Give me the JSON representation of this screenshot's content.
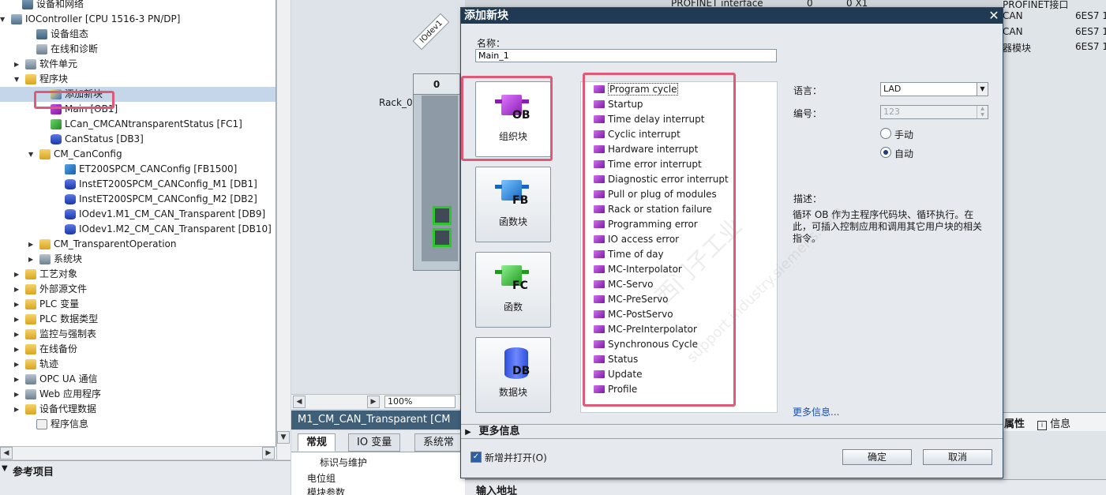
{
  "tree": {
    "items": [
      {
        "label": "设备和网络",
        "icon": "network-icon",
        "cls": "dev",
        "indent": 28,
        "toggle": ""
      },
      {
        "label": "IOController [CPU 1516-3 PN/DP]",
        "icon": "plc-icon",
        "cls": "plc",
        "indent": 14,
        "toggle": "▼"
      },
      {
        "label": "设备组态",
        "icon": "device-config-icon",
        "cls": "dev",
        "indent": 46,
        "toggle": ""
      },
      {
        "label": "在线和诊断",
        "icon": "online-diagnostics-icon",
        "cls": "gen",
        "indent": 46,
        "toggle": ""
      },
      {
        "label": "软件单元",
        "icon": "software-unit-icon",
        "cls": "gen",
        "indent": 32,
        "toggle": "▶"
      },
      {
        "label": "程序块",
        "icon": "folder-icon",
        "cls": "folder",
        "indent": 32,
        "toggle": "▼"
      },
      {
        "label": "添加新块",
        "icon": "add-block-icon",
        "cls": "add",
        "indent": 64,
        "toggle": "",
        "selected": true
      },
      {
        "label": "Main [OB1]",
        "icon": "ob-block-icon",
        "cls": "ob",
        "indent": 64,
        "toggle": ""
      },
      {
        "label": "LCan_CMCANtransparentStatus [FC1]",
        "icon": "fc-block-icon",
        "cls": "fc",
        "indent": 64,
        "toggle": ""
      },
      {
        "label": "CanStatus [DB3]",
        "icon": "db-block-icon",
        "cls": "db",
        "indent": 64,
        "toggle": ""
      },
      {
        "label": "CM_CanConfig",
        "icon": "folder-icon",
        "cls": "folder",
        "indent": 50,
        "toggle": "▼"
      },
      {
        "label": "ET200SPCM_CANConfig [FB1500]",
        "icon": "fb-block-icon",
        "cls": "fb",
        "indent": 82,
        "toggle": ""
      },
      {
        "label": "InstET200SPCM_CANConfig_M1 [DB1]",
        "icon": "db-block-icon",
        "cls": "db",
        "indent": 82,
        "toggle": ""
      },
      {
        "label": "InstET200SPCM_CANConfig_M2 [DB2]",
        "icon": "db-block-icon",
        "cls": "db",
        "indent": 82,
        "toggle": ""
      },
      {
        "label": "IOdev1.M1_CM_CAN_Transparent [DB9]",
        "icon": "db-block-icon",
        "cls": "db",
        "indent": 82,
        "toggle": ""
      },
      {
        "label": "IOdev1.M2_CM_CAN_Transparent [DB10]",
        "icon": "db-block-icon",
        "cls": "db",
        "indent": 82,
        "toggle": ""
      },
      {
        "label": "CM_TransparentOperation",
        "icon": "folder-icon",
        "cls": "folder",
        "indent": 50,
        "toggle": "▶"
      },
      {
        "label": "系统块",
        "icon": "system-block-icon",
        "cls": "gen",
        "indent": 50,
        "toggle": "▶"
      },
      {
        "label": "工艺对象",
        "icon": "technology-object-icon",
        "cls": "folder",
        "indent": 32,
        "toggle": "▶"
      },
      {
        "label": "外部源文件",
        "icon": "external-source-icon",
        "cls": "folder",
        "indent": 32,
        "toggle": "▶"
      },
      {
        "label": "PLC 变量",
        "icon": "plc-tags-icon",
        "cls": "folder",
        "indent": 32,
        "toggle": "▶"
      },
      {
        "label": "PLC 数据类型",
        "icon": "plc-datatype-icon",
        "cls": "folder",
        "indent": 32,
        "toggle": "▶"
      },
      {
        "label": "监控与强制表",
        "icon": "watch-table-icon",
        "cls": "folder",
        "indent": 32,
        "toggle": "▶"
      },
      {
        "label": "在线备份",
        "icon": "online-backup-icon",
        "cls": "folder",
        "indent": 32,
        "toggle": "▶"
      },
      {
        "label": "轨迹",
        "icon": "trace-icon",
        "cls": "folder",
        "indent": 32,
        "toggle": "▶"
      },
      {
        "label": "OPC UA 通信",
        "icon": "opcua-icon",
        "cls": "gen",
        "indent": 32,
        "toggle": "▶"
      },
      {
        "label": "Web 应用程序",
        "icon": "web-app-icon",
        "cls": "gen",
        "indent": 32,
        "toggle": "▶"
      },
      {
        "label": "设备代理数据",
        "icon": "device-proxy-icon",
        "cls": "folder",
        "indent": 32,
        "toggle": "▶"
      },
      {
        "label": "程序信息",
        "icon": "program-info-icon",
        "cls": "doc",
        "indent": 46,
        "toggle": ""
      }
    ]
  },
  "reference": {
    "title": "参考项目"
  },
  "device": {
    "iodev_label": "IOdev1",
    "rack_label": "Rack_0",
    "slot_number": "0",
    "zoom": "100%"
  },
  "properties": {
    "title": "M1_CM_CAN_Transparent [CM",
    "tabs": [
      "常规",
      "IO 变量",
      "系统常"
    ],
    "rows": [
      "标识与维护",
      "电位组",
      "模块参数"
    ]
  },
  "right": {
    "cells": [
      "PROFINET interface",
      "0",
      "0 X1",
      "PROFINET接口",
      "CAN",
      "6ES7 1",
      "CAN",
      "6ES7 1",
      "器模块",
      "6ES7 1"
    ],
    "tab_properties": "属性",
    "tab_info": "信息",
    "input_address": "输入地址"
  },
  "dialog": {
    "title": "添加新块",
    "name_label": "名称：",
    "name_value": "Main_1",
    "block_types": [
      {
        "label": "组织块",
        "suffix": "OB"
      },
      {
        "label": "函数块",
        "suffix": "FB"
      },
      {
        "label": "函数",
        "suffix": "FC"
      },
      {
        "label": "数据块",
        "suffix": "DB"
      }
    ],
    "ob_list": [
      "Program cycle",
      "Startup",
      "Time delay interrupt",
      "Cyclic interrupt",
      "Hardware interrupt",
      "Time error interrupt",
      "Diagnostic error interrupt",
      "Pull or plug of modules",
      "Rack or station failure",
      "Programming error",
      "IO access error",
      "Time of day",
      "MC-Interpolator",
      "MC-Servo",
      "MC-PreServo",
      "MC-PostServo",
      "MC-PreInterpolator",
      "Synchronous Cycle",
      "Status",
      "Update",
      "Profile"
    ],
    "language_label": "语言：",
    "language_value": "LAD",
    "number_label": "编号：",
    "number_value": "123",
    "manual_label": "手动",
    "auto_label": "自动",
    "description_label": "描述：",
    "description_text": "循环 OB 作为主程序代码块、循环执行。在此，可插入控制应用和调用其它用户块的相关指令。",
    "more_info_link": "更多信息...",
    "more_info_bar": "更多信息",
    "open_checkbox_label": "新增并打开(O)",
    "ok_label": "确定",
    "cancel_label": "取消"
  },
  "colors": {
    "titlebar": "#1f3a52",
    "highlight": "#e05a78",
    "port": "#2ec52e"
  }
}
